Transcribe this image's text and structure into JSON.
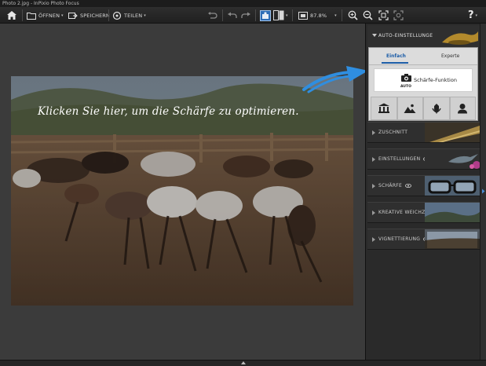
{
  "window": {
    "title": "Photo 2.jpg - InPixio Photo Focus"
  },
  "toolbar": {
    "open_label": "ÖFFNEN",
    "save_label": "SPEICHERN",
    "share_label": "TEILEN",
    "zoom_value": "87.8%",
    "help_label": "?"
  },
  "canvas": {
    "hint_text": "Klicken Sie hier, um die Schärfe zu optimieren."
  },
  "panel": {
    "auto": {
      "title": "AUTO-EINSTELLUNGEN",
      "tabs": [
        "Einfach",
        "Experte"
      ],
      "active_tab": "Einfach",
      "sharp_button": "Schärfe-Funktion",
      "auto_badge": "AUTO",
      "modes": [
        "architecture-icon",
        "landscape-icon",
        "flower-icon",
        "portrait-icon"
      ]
    },
    "sections": [
      {
        "label": "ZUSCHNITT",
        "eye": false
      },
      {
        "label": "EINSTELLUNGEN",
        "eye": true
      },
      {
        "label": "SCHÄRFE",
        "eye": true
      },
      {
        "label": "KREATIVE WEICHZEICHNUNG",
        "eye": true
      },
      {
        "label": "VIGNETTIERUNG",
        "eye": true
      }
    ]
  },
  "colors": {
    "accent": "#1e5ea8",
    "arrow": "#2f8ee0",
    "panel_bg": "#2a2a2a"
  }
}
